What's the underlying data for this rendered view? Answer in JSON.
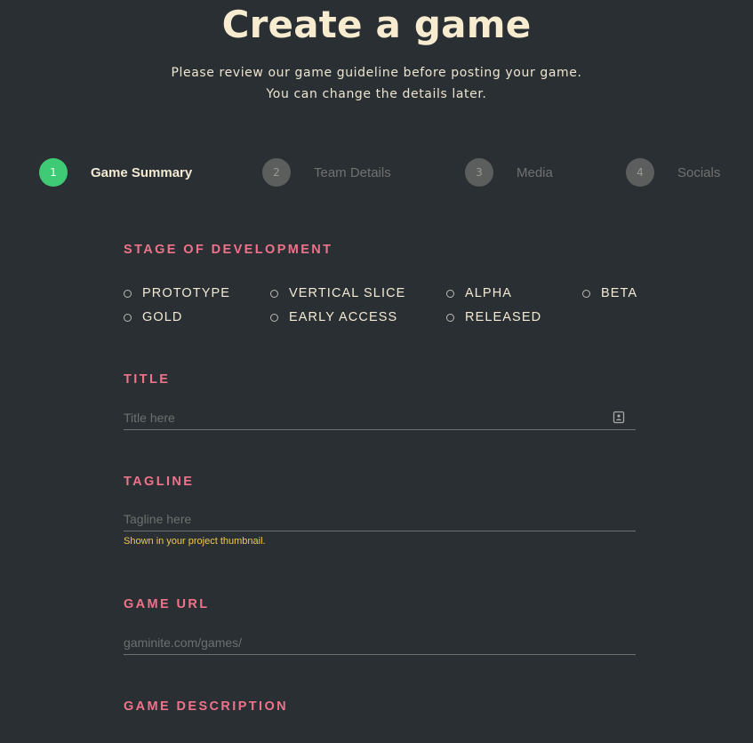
{
  "header": {
    "title": "Create a game",
    "subtitle_line1": "Please review our game guideline before posting your game.",
    "subtitle_line2": "You can change the details later."
  },
  "stepper": {
    "steps": [
      {
        "number": "1",
        "label": "Game Summary",
        "active": true
      },
      {
        "number": "2",
        "label": "Team Details",
        "active": false
      },
      {
        "number": "3",
        "label": "Media",
        "active": false
      },
      {
        "number": "4",
        "label": "Socials",
        "active": false
      }
    ],
    "active_color": "#3fcb76",
    "inactive_color": "#5b5e5c"
  },
  "stage": {
    "label": "STAGE OF DEVELOPMENT",
    "options": [
      "PROTOTYPE",
      "VERTICAL SLICE",
      "ALPHA",
      "BETA",
      "GOLD",
      "EARLY ACCESS",
      "RELEASED"
    ]
  },
  "title_field": {
    "label": "TITLE",
    "placeholder": "Title here",
    "icon": "contact-card-icon"
  },
  "tagline_field": {
    "label": "TAGLINE",
    "placeholder": "Tagline here",
    "hint": "Shown in your project thumbnail."
  },
  "url_field": {
    "label": "GAME URL",
    "placeholder": "gaminite.com/games/"
  },
  "description": {
    "label": "GAME DESCRIPTION"
  },
  "colors": {
    "background": "#2a2f33",
    "label_accent": "#f0728a",
    "hint": "#f1c94a",
    "text": "#f2ead3"
  }
}
